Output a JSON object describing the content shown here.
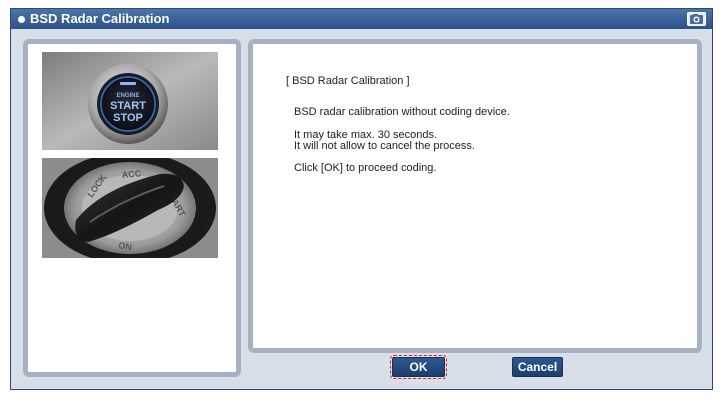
{
  "window": {
    "title": "BSD Radar Calibration"
  },
  "images": {
    "start_stop_button": {
      "label_line1": "ENGINE",
      "label_line2": "START",
      "label_line3": "STOP"
    },
    "ignition_key": {
      "label_lock": "LOCK",
      "label_acc": "ACC",
      "label_start": "START",
      "label_on": "ON"
    }
  },
  "message": {
    "heading": "[ BSD Radar Calibration ]",
    "line1": "BSD radar calibration without coding device.",
    "line2": "It may take max. 30 seconds.",
    "line3": "It will not allow to cancel the process.",
    "line4": "Click [OK] to proceed coding."
  },
  "buttons": {
    "ok": "OK",
    "cancel": "Cancel"
  },
  "colors": {
    "titlebar": "#2b5288",
    "dialog_bg": "#d9dfe8",
    "panel_border": "#a7b1c2",
    "button": "#1d3e6c",
    "focus_outline": "#e02020"
  },
  "icons": {
    "title": "bullet-icon",
    "camera": "camera-icon"
  }
}
